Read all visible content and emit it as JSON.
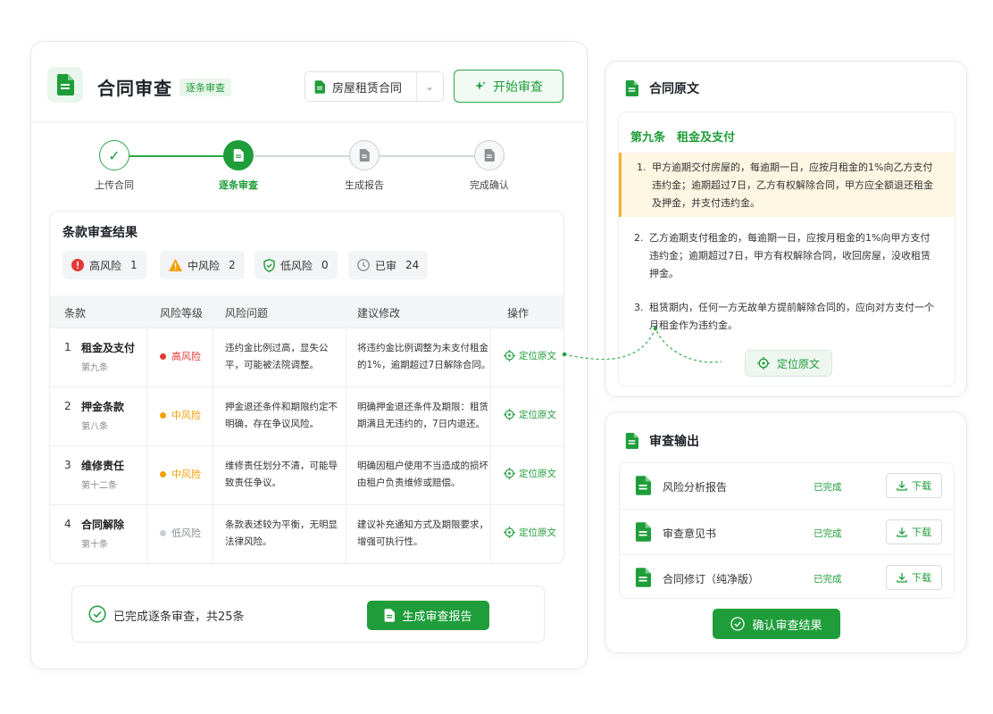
{
  "colors": {
    "accent": "#1f9d3a",
    "high": "#e53935",
    "medium": "#f59f00",
    "low": "#c9ccd0",
    "highlight": "#fdf6e3"
  },
  "header": {
    "title": "合同审查",
    "badge": "逐条审查",
    "contract_select": {
      "value": "房屋租赁合同",
      "icon": "document-icon"
    },
    "start_button": "开始审查"
  },
  "stepper": {
    "steps": [
      {
        "label": "上传合同",
        "state": "done",
        "icon": "check-icon"
      },
      {
        "label": "逐条审查",
        "state": "active",
        "icon": "document-icon"
      },
      {
        "label": "生成报告",
        "state": "pending",
        "icon": "document-icon"
      },
      {
        "label": "完成确认",
        "state": "pending",
        "icon": "document-icon"
      }
    ]
  },
  "results": {
    "title": "条款审查结果",
    "summary": [
      {
        "label": "高风险",
        "count": "1",
        "icon": "alert-circle-icon"
      },
      {
        "label": "中风险",
        "count": "2",
        "icon": "warning-triangle-icon"
      },
      {
        "label": "低风险",
        "count": "0",
        "icon": "shield-check-icon"
      },
      {
        "label": "已审",
        "count": "24",
        "icon": "clock-icon"
      }
    ],
    "columns": [
      "条款",
      "风险等级",
      "风险问题",
      "建议修改",
      "操作"
    ],
    "rows": [
      {
        "index": "1",
        "name": "租金及支付",
        "section": "第九条",
        "risk": "高风险",
        "risk_level": "high",
        "problem": "违约金比例过高，显失公平，可能被法院调整。",
        "suggestion": "将违约金比例调整为未支付租金的1%，逾期超过7日解除合同。",
        "action": "定位原文"
      },
      {
        "index": "2",
        "name": "押金条款",
        "section": "第八条",
        "risk": "中风险",
        "risk_level": "medium",
        "problem": "押金退还条件和期限约定不明确，存在争议风险。",
        "suggestion": "明确押金退还条件及期限：租赁期满且无违约的，7日内退还。",
        "action": "定位原文"
      },
      {
        "index": "3",
        "name": "维修责任",
        "section": "第十二条",
        "risk": "中风险",
        "risk_level": "medium",
        "problem": "维修责任划分不清，可能导致责任争议。",
        "suggestion": "明确因租户使用不当造成的损坏由租户负责维修或赔偿。",
        "action": "定位原文"
      },
      {
        "index": "4",
        "name": "合同解除",
        "section": "第十条",
        "risk": "低风险",
        "risk_level": "low",
        "problem": "条款表述较为平衡，无明显法律风险。",
        "suggestion": "建议补充通知方式及期限要求，增强可执行性。",
        "action": "定位原文"
      }
    ],
    "footer": {
      "message": "已完成逐条审查，共25条",
      "button": "生成审查报告"
    }
  },
  "original": {
    "title": "合同原文",
    "article_title": "第九条　租金及支付",
    "clauses": [
      {
        "n": "1.",
        "text": "甲方逾期交付房屋的，每逾期一日，应按月租金的1%向乙方支付违约金；逾期超过7日，乙方有权解除合同，甲方应全额退还租金及押金，并支付违约金。",
        "highlighted": true
      },
      {
        "n": "2.",
        "text": "乙方逾期支付租金的，每逾期一日，应按月租金的1%向甲方支付违约金；逾期超过7日，甲方有权解除合同，收回房屋，没收租赁押金。",
        "highlighted": false
      },
      {
        "n": "3.",
        "text": "租赁期内，任何一方无故单方提前解除合同的，应向对方支付一个月租金作为违约金。",
        "highlighted": false
      }
    ],
    "locate_button": "定位原文"
  },
  "output": {
    "title": "审查输出",
    "items": [
      {
        "name": "风险分析报告",
        "status": "已完成",
        "button": "下载"
      },
      {
        "name": "审查意见书",
        "status": "已完成",
        "button": "下载"
      },
      {
        "name": "合同修订（纯净版）",
        "status": "已完成",
        "button": "下载"
      }
    ],
    "confirm_button": "确认审查结果"
  }
}
